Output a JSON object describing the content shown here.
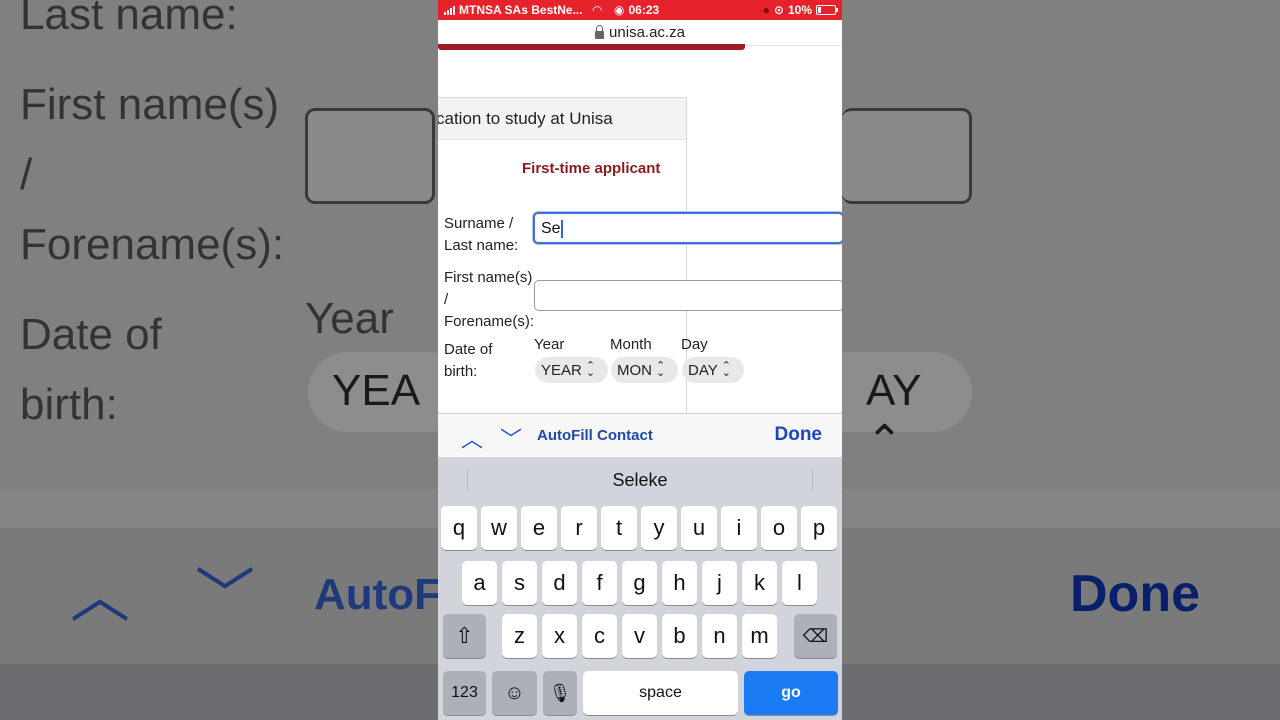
{
  "background": {
    "last_name": "Last name:",
    "first_names": "First name(s)",
    "slash": "/",
    "forenames": "Forename(s):",
    "date_of": "Date of",
    "birth": "birth:",
    "year": "Year",
    "year_pill": "YEA",
    "day_pill": "AY",
    "autofill": "AutoF",
    "done": "Done"
  },
  "status_bar": {
    "carrier": "MTNSA SAs BestNe...",
    "time": "06:23",
    "battery": "10%"
  },
  "browser": {
    "url": "unisa.ac.za"
  },
  "form": {
    "header": "cation to study at Unisa",
    "subheading": "First-time applicant",
    "surname_label_1": "Surname /",
    "surname_label_2": "Last name:",
    "surname_value": "Se",
    "first_label_1": "First name(s)",
    "first_label_2": "/",
    "first_label_3": "Forename(s):",
    "first_value": "",
    "dob_label_1": "Date of",
    "dob_label_2": "birth:",
    "year_label": "Year",
    "month_label": "Month",
    "day_label": "Day",
    "year_select": "YEAR",
    "month_select": "MON",
    "day_select": "DAY"
  },
  "accessory": {
    "autofill": "AutoFill Contact",
    "done": "Done"
  },
  "keyboard": {
    "suggestion": "Seleke",
    "row1": [
      "q",
      "w",
      "e",
      "r",
      "t",
      "y",
      "u",
      "i",
      "o",
      "p"
    ],
    "row2": [
      "a",
      "s",
      "d",
      "f",
      "g",
      "h",
      "j",
      "k",
      "l"
    ],
    "row3": [
      "z",
      "x",
      "c",
      "v",
      "b",
      "n",
      "m"
    ],
    "num_key": "123",
    "space_key": "space",
    "go_key": "go"
  },
  "colors": {
    "status_bar": "#e8222b",
    "brand_red": "#8b1a1f",
    "focus_blue": "#3f6fd1",
    "go_blue": "#1a7cf5"
  }
}
